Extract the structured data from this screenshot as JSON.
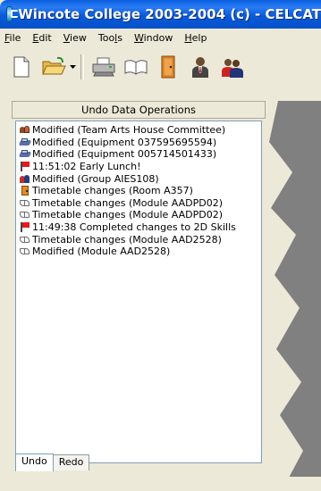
{
  "window": {
    "title": "Wincote College 2003-2004 (c) - CELCAT"
  },
  "menu": [
    {
      "label": "File",
      "mnemonic": "F",
      "rest": "ile"
    },
    {
      "label": "Edit",
      "mnemonic": "E",
      "rest": "dit"
    },
    {
      "label": "View",
      "mnemonic": "V",
      "rest": "iew"
    },
    {
      "label": "Tools",
      "pre": "Too",
      "mnemonic": "l",
      "rest": "s"
    },
    {
      "label": "Window",
      "mnemonic": "W",
      "rest": "indow"
    },
    {
      "label": "Help",
      "mnemonic": "H",
      "rest": "elp"
    }
  ],
  "toolbar": {
    "buttons": [
      "new-document-icon",
      "open-folder-icon",
      "dropdown-arrow-icon",
      "printer-icon",
      "book-icon",
      "door-icon",
      "staff-icon",
      "group-icon"
    ]
  },
  "panel": {
    "title": "Undo Data Operations",
    "items": [
      {
        "icon": "team",
        "text": "Modified (Team Arts House Committee)"
      },
      {
        "icon": "equip",
        "text": "Modified (Equipment 037595695594)"
      },
      {
        "icon": "equip",
        "text": "Modified (Equipment 005714501433)"
      },
      {
        "icon": "flag",
        "text": "11:51:02 Early Lunch!"
      },
      {
        "icon": "group",
        "text": "Modified (Group AIES108)"
      },
      {
        "icon": "room",
        "text": "Timetable changes (Room A357)"
      },
      {
        "icon": "module",
        "text": "Timetable changes (Module AADPD02)"
      },
      {
        "icon": "module",
        "text": "Timetable changes (Module AADPD02)"
      },
      {
        "icon": "flag",
        "text": "11:49:38 Completed changes to 2D Skills"
      },
      {
        "icon": "module",
        "text": "Timetable changes (Module AAD2528)"
      },
      {
        "icon": "module",
        "text": "Modified (Module AAD2528)"
      }
    ],
    "tabs": [
      {
        "label": "Undo",
        "active": true
      },
      {
        "label": "Redo",
        "active": false
      }
    ]
  },
  "colors": {
    "titlebar": "#0a5ad8",
    "face": "#ece9d8",
    "workspace": "#808080"
  }
}
